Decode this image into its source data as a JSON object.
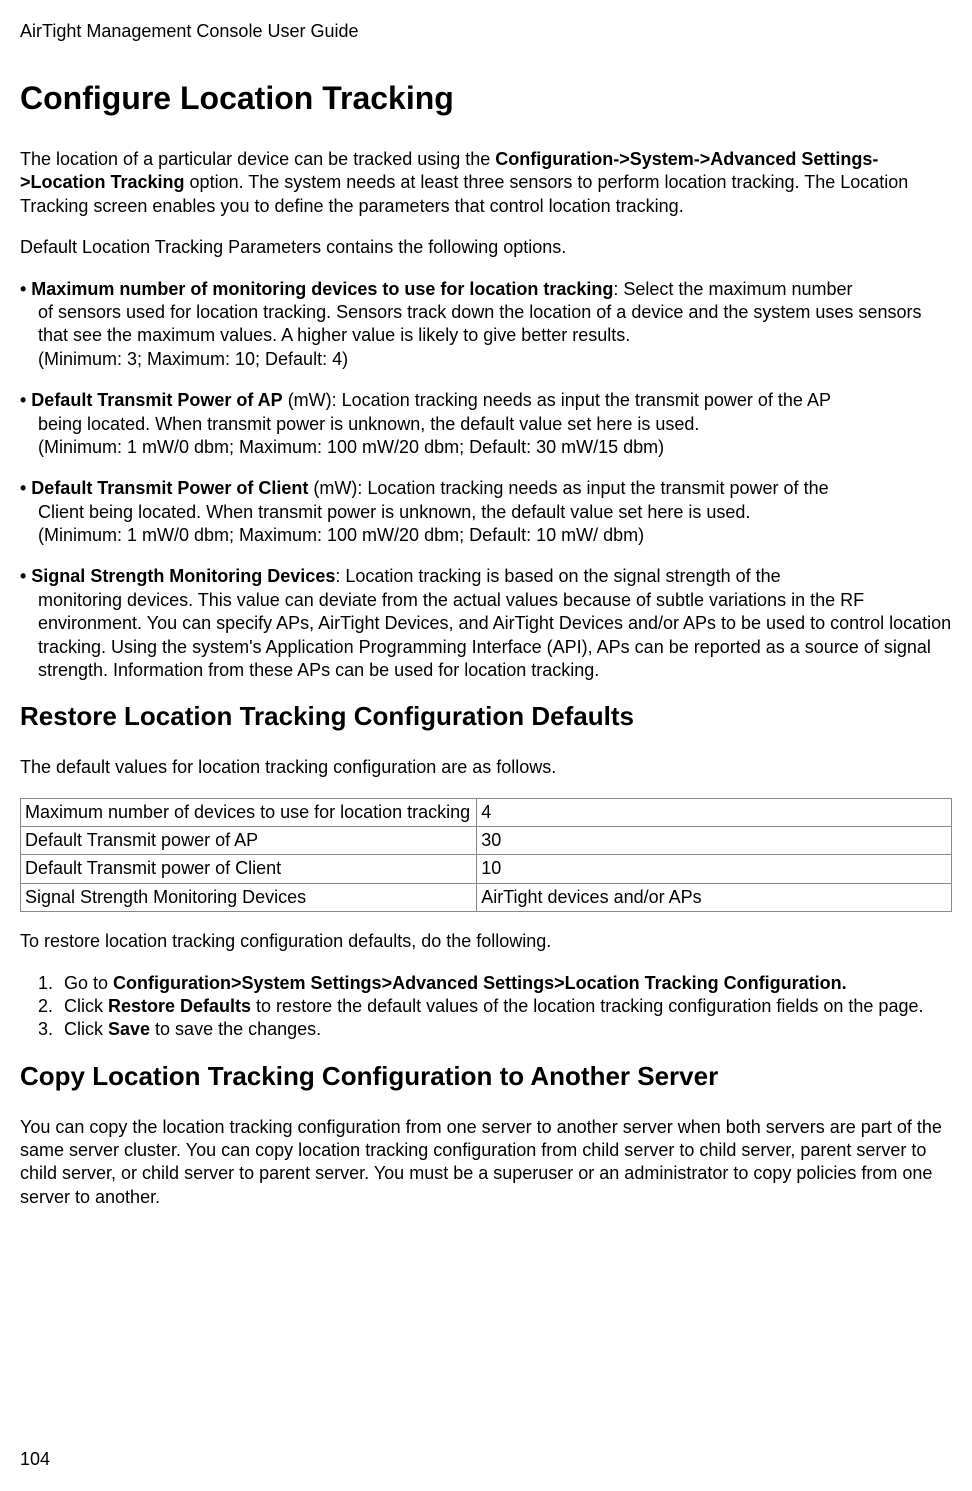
{
  "header": {
    "doc_title": "AirTight Management Console User Guide"
  },
  "main": {
    "h1": "Configure Location Tracking",
    "intro_p1_part1": "The location of a particular device can be tracked using the ",
    "intro_p1_bold": "Configuration->System->Advanced Settings->Location Tracking",
    "intro_p1_part2": " option. The system needs at least three sensors to perform location tracking. The Location Tracking screen enables you to define the parameters that control location tracking.",
    "intro_p2": "Default Location Tracking Parameters contains the following options.",
    "bullets": [
      {
        "lead_bold": "• Maximum number of monitoring devices to use for location tracking",
        "lead_rest": ": Select the maximum number",
        "indent_text": "of sensors used for location tracking. Sensors track down the location of a device and the system uses sensors that see the maximum values. A higher value is likely to give better results.\n(Minimum: 3; Maximum: 10; Default: 4)"
      },
      {
        "lead_bold": "• Default Transmit Power of AP",
        "lead_rest": " (mW): Location tracking needs as input the transmit power of the AP",
        "indent_text": "being located. When transmit power is unknown, the default value set here is used.\n(Minimum: 1 mW/0 dbm; Maximum: 100 mW/20 dbm; Default: 30 mW/15 dbm)"
      },
      {
        "lead_bold": "• Default Transmit Power of Client",
        "lead_rest": " (mW): Location tracking needs as input the transmit power of the",
        "indent_text": "Client being located. When transmit power is unknown, the default value set here is used.\n(Minimum: 1 mW/0 dbm; Maximum: 100 mW/20 dbm; Default: 10 mW/ dbm)"
      },
      {
        "lead_bold": "• Signal Strength Monitoring Devices",
        "lead_rest": ": Location tracking is based on the signal strength of the",
        "indent_text": "monitoring devices. This value can deviate from the actual values because of subtle variations in the RF environment. You can specify APs, AirTight Devices, and AirTight Devices and/or APs to be used to control location tracking. Using the system's Application Programming Interface (API), APs can be reported as a source of signal strength. Information from these APs can be used for location tracking."
      }
    ],
    "h2_restore": "Restore Location Tracking Configuration Defaults",
    "restore_intro": "The default values for location tracking configuration are as follows.",
    "table": {
      "rows": [
        {
          "col1": "Maximum number of devices to use for location tracking",
          "col2": "4"
        },
        {
          "col1": "Default Transmit power of AP",
          "col2": "30"
        },
        {
          "col1": "Default Transmit power of Client",
          "col2": "10"
        },
        {
          "col1": "Signal Strength Monitoring Devices",
          "col2": "AirTight devices and/or APs"
        }
      ]
    },
    "restore_steps_intro": "To restore location tracking configuration defaults, do the following.",
    "steps": [
      {
        "pre": "Go to ",
        "bold": "Configuration>System Settings>Advanced Settings>Location Tracking Configuration.",
        "post": ""
      },
      {
        "pre": "Click ",
        "bold": "Restore Defaults",
        "post": " to restore the default values of the location tracking configuration fields on the page."
      },
      {
        "pre": "Click ",
        "bold": "Save",
        "post": " to save the changes."
      }
    ],
    "h2_copy": "Copy Location Tracking Configuration to Another Server",
    "copy_p": "You can copy the location tracking configuration from one server to another server when both servers are part of the same server cluster. You can copy location tracking configuration from child server to child server, parent server to child server, or child server to parent server. You must be a superuser or an administrator to copy policies from one server to another."
  },
  "footer": {
    "page_number": "104"
  }
}
